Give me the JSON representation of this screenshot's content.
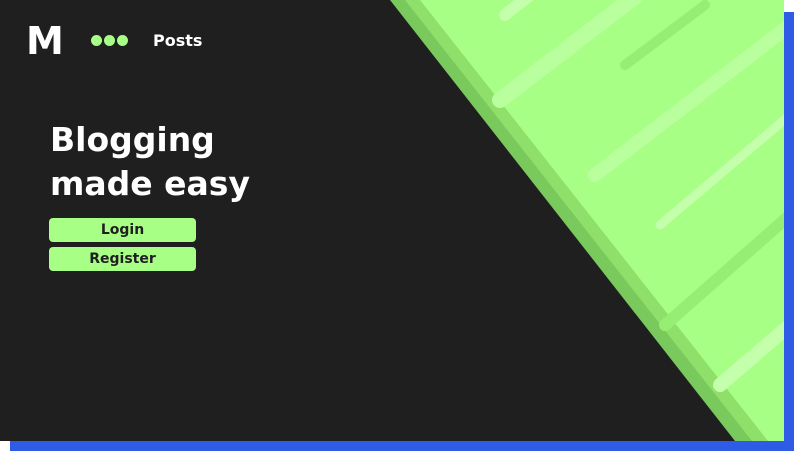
{
  "brand": {
    "logo": "M"
  },
  "nav": {
    "menu_icon": "dots-menu-icon",
    "posts_label": "Posts"
  },
  "hero": {
    "title_line1": "Blogging",
    "title_line2": "made easy"
  },
  "actions": {
    "login_label": "Login",
    "register_label": "Register"
  },
  "colors": {
    "accent": "#a8ff85",
    "background": "#1f1f1f",
    "shadow": "#2e5ce6"
  }
}
